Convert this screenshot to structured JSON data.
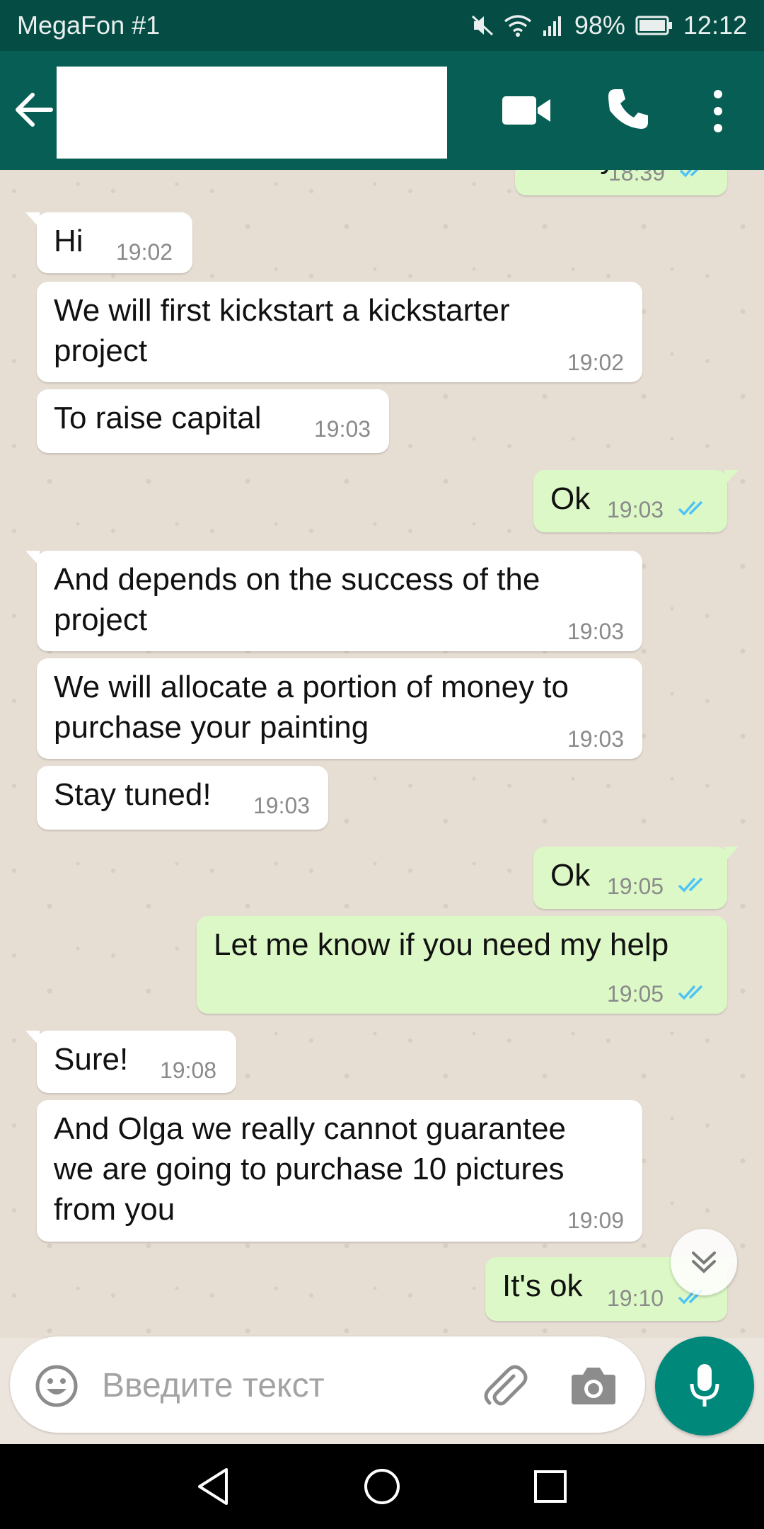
{
  "status_bar": {
    "carrier": "MegaFon #1",
    "battery": "98%",
    "time": "12:12"
  },
  "app_bar": {
    "contact_name": ""
  },
  "messages": [
    {
      "text": "Hey",
      "time": "18:39",
      "dir": "out",
      "read": true
    },
    {
      "text": "Hi",
      "time": "19:02",
      "dir": "in"
    },
    {
      "text": "We will first kickstart a kickstarter\nproject",
      "time": "19:02",
      "dir": "in"
    },
    {
      "text": "To raise capital",
      "time": "19:03",
      "dir": "in"
    },
    {
      "text": "Ok",
      "time": "19:03",
      "dir": "out",
      "read": true
    },
    {
      "text": "And depends on the success of the\nproject",
      "time": "19:03",
      "dir": "in"
    },
    {
      "text": "We will allocate a portion of money to\npurchase your painting",
      "time": "19:03",
      "dir": "in"
    },
    {
      "text": "Stay tuned!",
      "time": "19:03",
      "dir": "in"
    },
    {
      "text": "Ok",
      "time": "19:05",
      "dir": "out",
      "read": true
    },
    {
      "text": "Let me know if you need my help",
      "time": "19:05",
      "dir": "out",
      "read": true
    },
    {
      "text": "Sure!",
      "time": "19:08",
      "dir": "in"
    },
    {
      "text": "And Olga we really cannot guarantee\nwe are going to purchase 10 pictures\nfrom you",
      "time": "19:09",
      "dir": "in"
    },
    {
      "text": "It's ok",
      "time": "19:10",
      "dir": "out",
      "read": true
    }
  ],
  "composer": {
    "placeholder": "Введите текст"
  },
  "colors": {
    "header": "#075e54",
    "status_bar": "#054d44",
    "incoming_bubble": "#ffffff",
    "outgoing_bubble": "#dcf8c6",
    "mic_button": "#00897b",
    "read_ticks": "#4fc3f7"
  },
  "icons": {
    "back": "arrow-left-icon",
    "video": "video-camera-icon",
    "call": "phone-icon",
    "more": "more-vert-icon",
    "emoji": "emoji-icon",
    "attach": "paperclip-icon",
    "camera": "camera-icon",
    "mic": "microphone-icon",
    "scroll_down": "double-chevron-down-icon"
  }
}
